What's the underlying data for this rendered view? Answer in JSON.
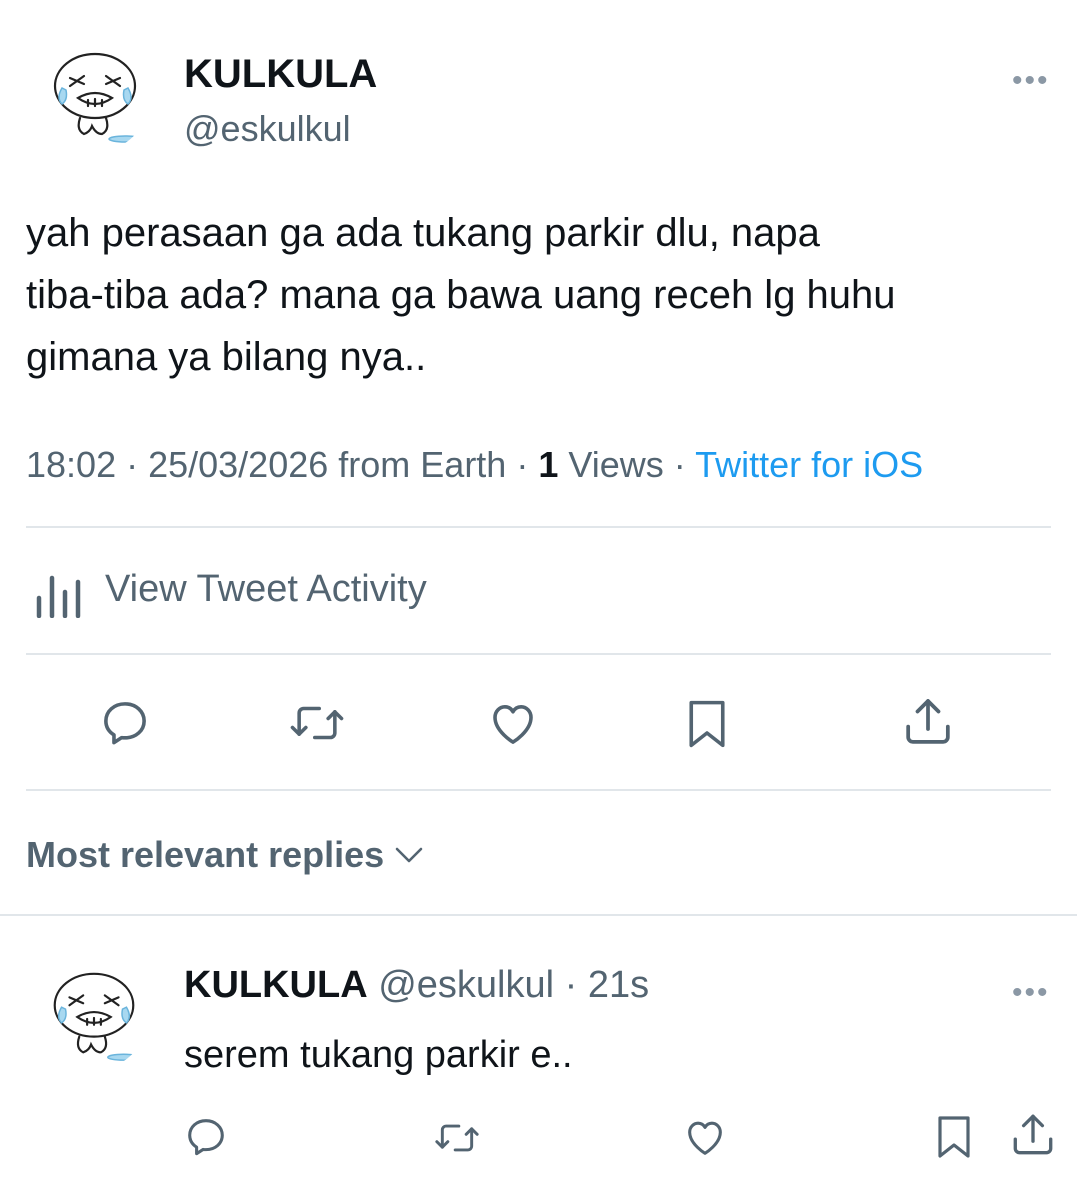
{
  "tweet": {
    "author_name": "KULKULA",
    "author_handle": "@eskulkul",
    "more_glyph": "•••",
    "text_lines": [
      "yah perasaan ga ada tukang parkir dlu, napa",
      "tiba-tiba ada? mana ga bawa uang receh lg huhu",
      "gimana ya bilang nya.."
    ],
    "meta": {
      "time": "18:02",
      "sep1": " · ",
      "date": "25/03/2026",
      "location": " from Earth",
      "sep2": " · ",
      "views_count": "1",
      "views_label": " Views",
      "sep3": " · ",
      "client": "Twitter for iOS"
    },
    "activity_label": "View Tweet Activity",
    "actions": [
      "reply-icon",
      "retweet-icon",
      "like-icon",
      "bookmark-icon",
      "share-icon"
    ]
  },
  "replies": {
    "sort_label": "Most relevant replies",
    "items": [
      {
        "author_name": "KULKULA",
        "author_handle": "@eskulkul",
        "sep": " · ",
        "time_ago": "21s",
        "more_glyph": "•••",
        "text": "serem tukang parkir e.."
      }
    ]
  },
  "colors": {
    "text": "#0f1419",
    "secondary": "#536471",
    "link": "#1d9bf0",
    "divider": "#e1e6ea"
  }
}
